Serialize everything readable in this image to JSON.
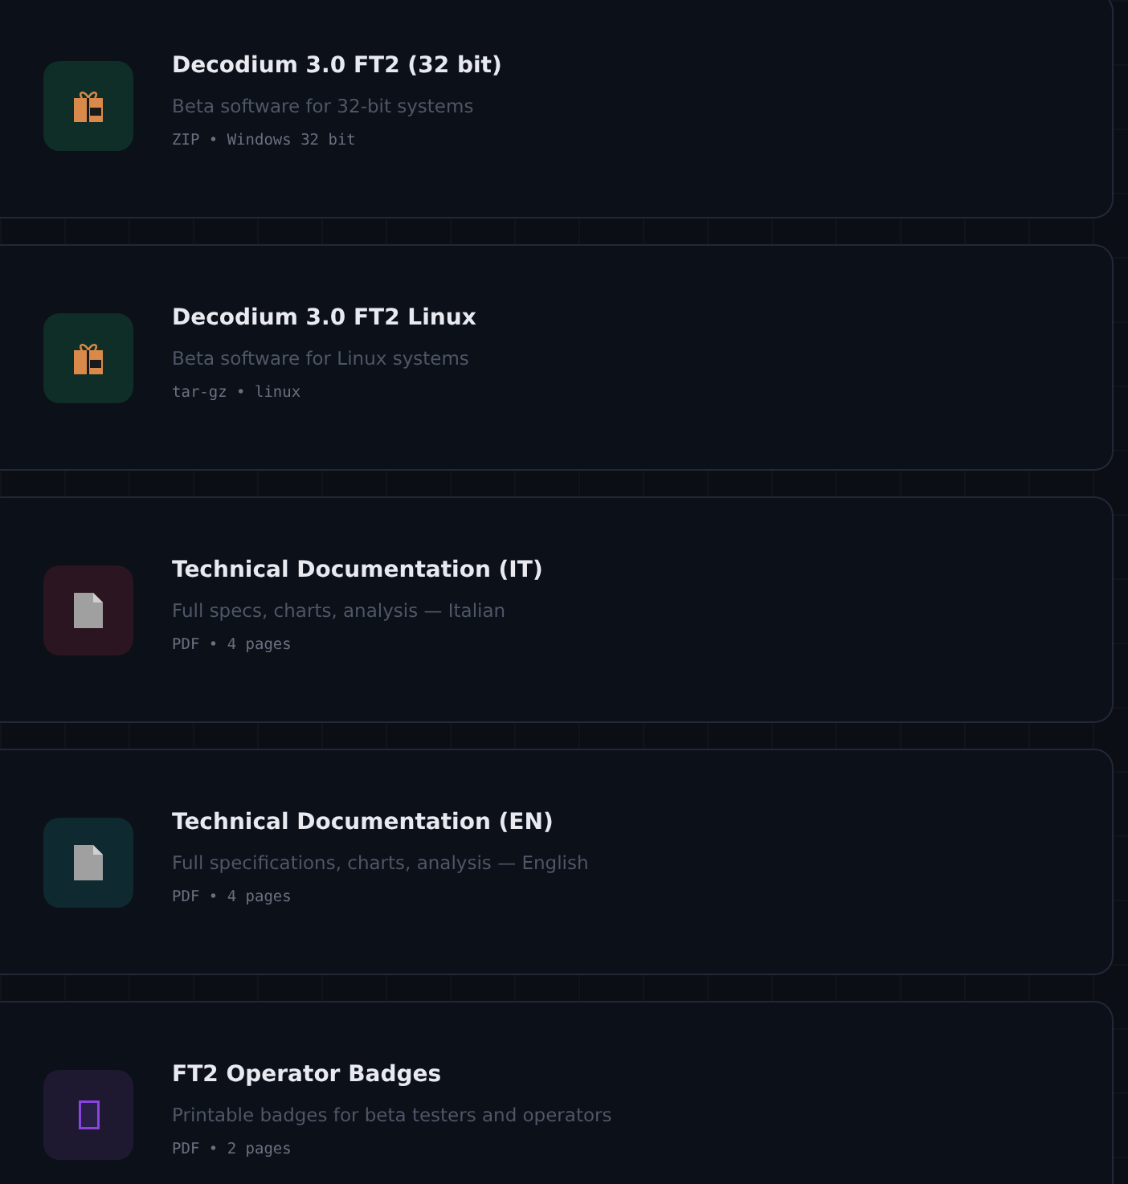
{
  "downloads": [
    {
      "title": "Decodium 3.0 FT2 (32 bit)",
      "description": "Beta software for 32-bit systems",
      "meta": "ZIP • Windows 32 bit",
      "kind": "package",
      "color": "#0f2e27"
    },
    {
      "title": "Decodium 3.0 FT2 Linux",
      "description": "Beta software for Linux systems",
      "meta": "tar-gz • linux",
      "kind": "package",
      "color": "#0f2e27"
    },
    {
      "title": "Technical Documentation (IT)",
      "description": "Full specs, charts, analysis — Italian",
      "meta": "PDF • 4 pages",
      "kind": "document",
      "color": "#2a1520"
    },
    {
      "title": "Technical Documentation (EN)",
      "description": "Full specifications, charts, analysis — English",
      "meta": "PDF • 4 pages",
      "kind": "document",
      "color": "#0e2a30"
    },
    {
      "title": "FT2 Operator Badges",
      "description": "Printable badges for beta testers and operators",
      "meta": "PDF • 2 pages",
      "kind": "badge",
      "color": "#1e1830"
    }
  ]
}
